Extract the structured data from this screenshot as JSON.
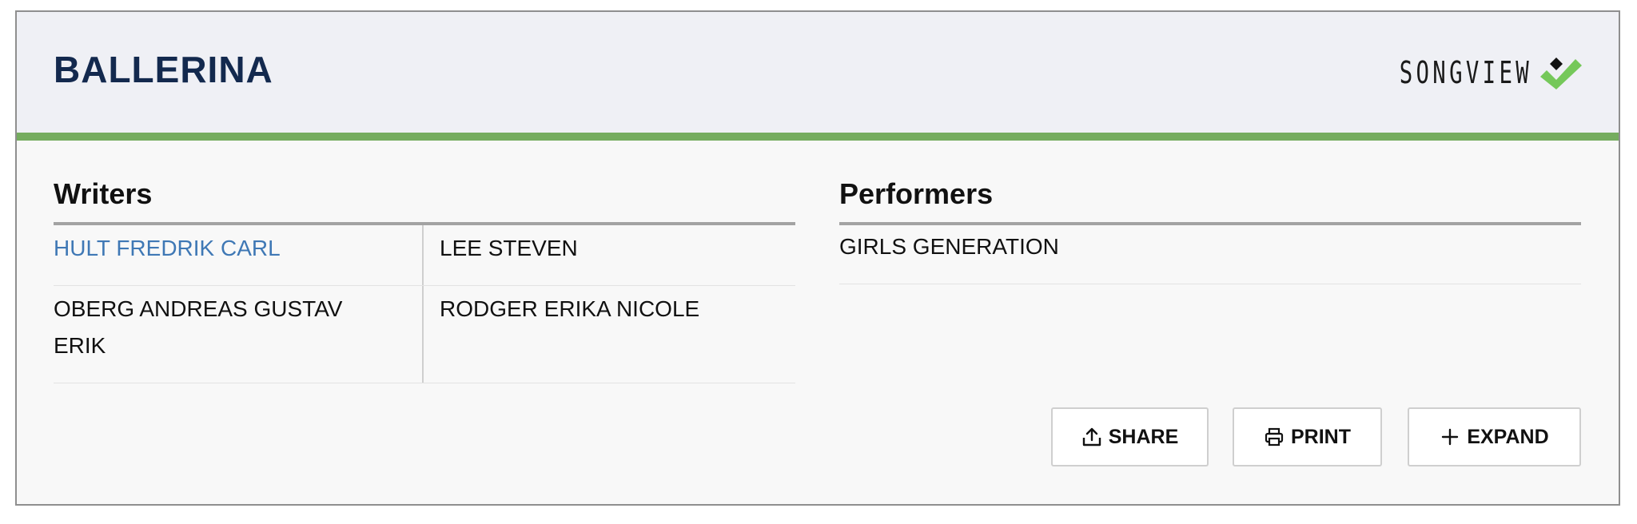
{
  "song": {
    "title": "BALLERINA"
  },
  "brand": {
    "name": "SONGVIEW",
    "mark_colors": [
      "#75c85a",
      "#111111"
    ]
  },
  "writers": {
    "heading": "Writers",
    "rows": [
      [
        "HULT FREDRIK CARL",
        "LEE STEVEN"
      ],
      [
        "OBERG ANDREAS GUSTAV ERIK",
        "RODGER ERIKA NICOLE"
      ]
    ]
  },
  "performers": {
    "heading": "Performers",
    "items": [
      "GIRLS GENERATION"
    ]
  },
  "actions": {
    "share": {
      "label": "SHARE",
      "icon": "share-upload-icon"
    },
    "print": {
      "label": "PRINT",
      "icon": "printer-icon"
    },
    "expand": {
      "label": "EXPAND",
      "icon": "plus-icon"
    }
  },
  "colors": {
    "header_bg": "#eff0f5",
    "accent_rule": "#75ac5f",
    "title": "#13294e",
    "link": "#3f78b5"
  }
}
